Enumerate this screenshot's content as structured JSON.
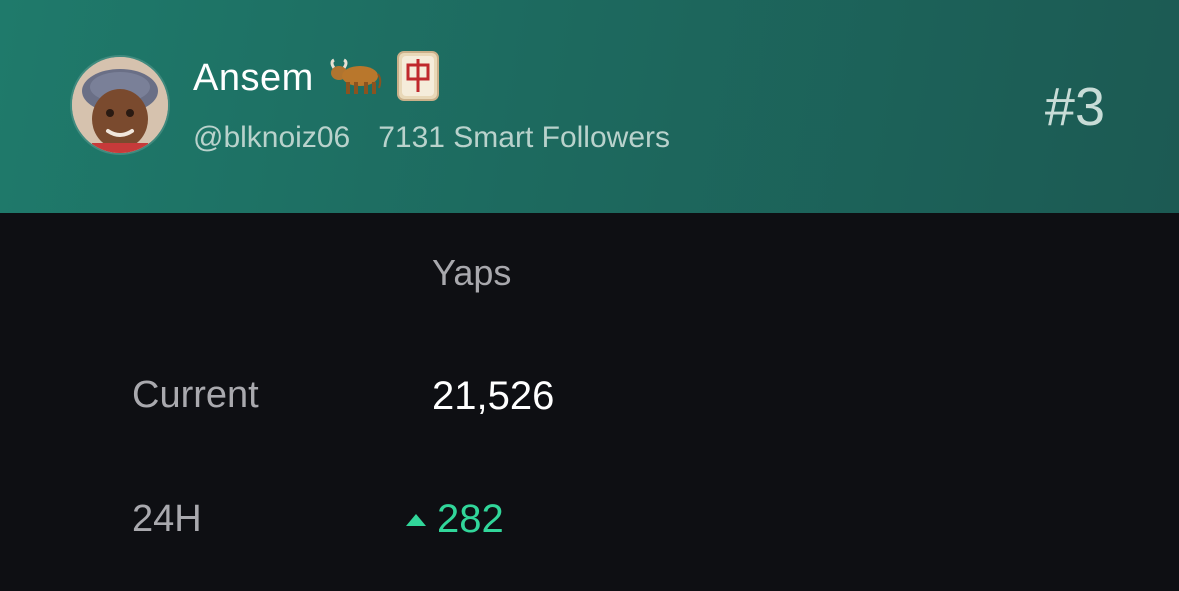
{
  "profile": {
    "name": "Ansem",
    "handle": "@blknoiz06",
    "smart_followers": "7131 Smart Followers",
    "rank": "#3",
    "emojis": [
      "ox-emoji",
      "mahjong-red-dragon-emoji"
    ]
  },
  "table": {
    "column_header": "Yaps",
    "rows": [
      {
        "label": "Current",
        "value": "21,526"
      },
      {
        "label": "24H",
        "value": "282",
        "trend": "up"
      }
    ]
  },
  "colors": {
    "header_gradient_start": "#1f7a6b",
    "header_gradient_end": "#1c5a53",
    "background": "#0e0f13",
    "positive": "#31d69a"
  }
}
